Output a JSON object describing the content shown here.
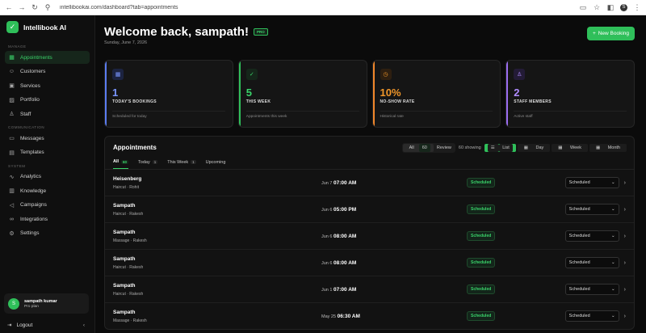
{
  "browser": {
    "url": "intellibookai.com/dashboard?tab=appointments",
    "profile_initial": "S"
  },
  "brand": {
    "name": "Intellibook AI",
    "accent": "#2fbf5a"
  },
  "sidebar": {
    "sections": [
      {
        "label": "MANAGE",
        "items": [
          {
            "label": "Appointments",
            "icon": "calendar-icon",
            "glyph": "▦",
            "active": true
          },
          {
            "label": "Customers",
            "icon": "users-icon",
            "glyph": "☺"
          },
          {
            "label": "Services",
            "icon": "briefcase-icon",
            "glyph": "▣"
          },
          {
            "label": "Portfolio",
            "icon": "image-icon",
            "glyph": "▨"
          },
          {
            "label": "Staff",
            "icon": "user-icon",
            "glyph": "♙"
          }
        ]
      },
      {
        "label": "COMMUNICATION",
        "items": [
          {
            "label": "Messages",
            "icon": "message-icon",
            "glyph": "▭"
          },
          {
            "label": "Templates",
            "icon": "template-icon",
            "glyph": "▤"
          }
        ]
      },
      {
        "label": "SYSTEM",
        "items": [
          {
            "label": "Analytics",
            "icon": "analytics-icon",
            "glyph": "∿"
          },
          {
            "label": "Knowledge",
            "icon": "book-icon",
            "glyph": "▥"
          },
          {
            "label": "Campaigns",
            "icon": "megaphone-icon",
            "glyph": "◁"
          },
          {
            "label": "Integrations",
            "icon": "link-icon",
            "glyph": "∞"
          },
          {
            "label": "Settings",
            "icon": "gear-icon",
            "glyph": "⚙"
          }
        ]
      }
    ],
    "user": {
      "initial": "S",
      "name": "sampath kumar",
      "plan": "Pro plan"
    },
    "logout_label": "Logout"
  },
  "header": {
    "welcome": "Welcome back, sampath!",
    "badge": "PRO",
    "date": "Sunday, June 7, 2026",
    "new_booking_label": "New Booking"
  },
  "stats": [
    {
      "value": "1",
      "label": "TODAY'S BOOKINGS",
      "sub": "Scheduled for today",
      "icon": "calendar-icon",
      "glyph": "▦",
      "color": "blue"
    },
    {
      "value": "5",
      "label": "THIS WEEK",
      "sub": "Appointments this week",
      "icon": "check-circle-icon",
      "glyph": "✓",
      "color": "green"
    },
    {
      "value": "10%",
      "label": "NO-SHOW RATE",
      "sub": "Historical rate",
      "icon": "clock-icon",
      "glyph": "◷",
      "color": "orange"
    },
    {
      "value": "2",
      "label": "STAFF MEMBERS",
      "sub": "Active staff",
      "icon": "user-icon",
      "glyph": "♙",
      "color": "purple"
    }
  ],
  "appointments": {
    "title": "Appointments",
    "filter": {
      "all": "All",
      "all_count": "60",
      "review": "Review"
    },
    "showing": "60 showing",
    "views": [
      "List",
      "Day",
      "Week",
      "Month"
    ],
    "tabs": [
      {
        "label": "All",
        "count": "60",
        "active": true
      },
      {
        "label": "Today",
        "count": "1"
      },
      {
        "label": "This Week",
        "count": "1"
      },
      {
        "label": "Upcoming",
        "count": ""
      }
    ],
    "rows": [
      {
        "name": "Heisenberg",
        "service": "Haircut · Rohit",
        "date": "Jun 7",
        "time": "07:00 AM",
        "status": "Scheduled",
        "select": "Scheduled"
      },
      {
        "name": "Sampath",
        "service": "Haircut · Rakesh",
        "date": "Jun 6",
        "time": "05:00 PM",
        "status": "Scheduled",
        "select": "Scheduled"
      },
      {
        "name": "Sampath",
        "service": "Massage · Rakesh",
        "date": "Jun 6",
        "time": "08:00 AM",
        "status": "Scheduled",
        "select": "Scheduled"
      },
      {
        "name": "Sampath",
        "service": "Haircut · Rakesh",
        "date": "Jun 6",
        "time": "08:00 AM",
        "status": "Scheduled",
        "select": "Scheduled"
      },
      {
        "name": "Sampath",
        "service": "Haircut · Rakesh",
        "date": "Jun 1",
        "time": "07:00 AM",
        "status": "Scheduled",
        "select": "Scheduled"
      },
      {
        "name": "Sampath",
        "service": "Massage · Rakesh",
        "date": "May 25",
        "time": "06:30 AM",
        "status": "Scheduled",
        "select": "Scheduled"
      }
    ]
  }
}
